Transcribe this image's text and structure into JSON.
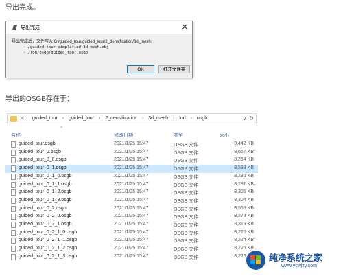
{
  "article": {
    "heading1": "导出完成。",
    "heading2": "导出的OSGB存在于："
  },
  "dialog": {
    "title": "导出完成",
    "close": "✕",
    "line1": "导出完成后，文件写入 G:/guided_tour/guided_tour/2_densification/3d_mesh:",
    "line2": "     - /guided_tour_simplified_3d_mesh.obj",
    "line3": "     - /lod/osgb/guided_tour.osgb",
    "ok_label": "OK",
    "open_label": "打开文件夹"
  },
  "explorer": {
    "address": {
      "prefix": "«",
      "segments": [
        "guided_tour",
        "guided_tour",
        "2_densification",
        "3d_mesh",
        "lod",
        "osgb"
      ],
      "dropdown": "∨",
      "refresh": "↻"
    },
    "columns": {
      "name": "名称",
      "date": "修改日期",
      "type": "类型",
      "size": "大小"
    },
    "files": [
      {
        "name": "guided_tour.osgb",
        "date": "2021/1/25 15:47",
        "type": "OSGB 文件",
        "size": "8,442 KB",
        "selected": false
      },
      {
        "name": "guided_tour_0.osgb",
        "date": "2021/1/25 15:47",
        "type": "OSGB 文件",
        "size": "8,667 KB",
        "selected": false
      },
      {
        "name": "guided_tour_0_0.osgb",
        "date": "2021/1/25 15:47",
        "type": "OSGB 文件",
        "size": "8,264 KB",
        "selected": false
      },
      {
        "name": "guided_tour_0_1.osgb",
        "date": "2021/1/25 15:47",
        "type": "OSGB 文件",
        "size": "8,538 KB",
        "selected": true
      },
      {
        "name": "guided_tour_0_1_0.osgb",
        "date": "2021/1/25 15:47",
        "type": "OSGB 文件",
        "size": "8,232 KB",
        "selected": false
      },
      {
        "name": "guided_tour_0_1_1.osgb",
        "date": "2021/1/25 15:47",
        "type": "OSGB 文件",
        "size": "8,281 KB",
        "selected": false
      },
      {
        "name": "guided_tour_0_1_2.osgb",
        "date": "2021/1/25 15:47",
        "type": "OSGB 文件",
        "size": "8,305 KB",
        "selected": false
      },
      {
        "name": "guided_tour_0_1_3.osgb",
        "date": "2021/1/25 15:47",
        "type": "OSGB 文件",
        "size": "8,304 KB",
        "selected": false
      },
      {
        "name": "guided_tour_0_2.osgb",
        "date": "2021/1/25 15:47",
        "type": "OSGB 文件",
        "size": "8,569 KB",
        "selected": false
      },
      {
        "name": "guided_tour_0_2_0.osgb",
        "date": "2021/1/25 15:47",
        "type": "OSGB 文件",
        "size": "8,278 KB",
        "selected": false
      },
      {
        "name": "guided_tour_0_2_1.osgb",
        "date": "2021/1/25 15:47",
        "type": "OSGB 文件",
        "size": "8,319 KB",
        "selected": false
      },
      {
        "name": "guided_tour_0_2_1_0.osgb",
        "date": "2021/1/25 15:47",
        "type": "OSGB 文件",
        "size": "8,225 KB",
        "selected": false
      },
      {
        "name": "guided_tour_0_2_1_1.osgb",
        "date": "2021/1/25 15:47",
        "type": "OSGB 文件",
        "size": "8,224 KB",
        "selected": false
      },
      {
        "name": "guided_tour_0_2_1_2.osgb",
        "date": "2021/1/25 15:47",
        "type": "OSGB 文件",
        "size": "8,225 KB",
        "selected": false
      },
      {
        "name": "guided_tour_0_2_1_3.osgb",
        "date": "2021/1/25 15:47",
        "type": "OSGB 文件",
        "size": "8,226 KB",
        "selected": false
      }
    ]
  },
  "watermark": {
    "title": "纯净系统之家",
    "url": "www.ycwjzy.com"
  }
}
